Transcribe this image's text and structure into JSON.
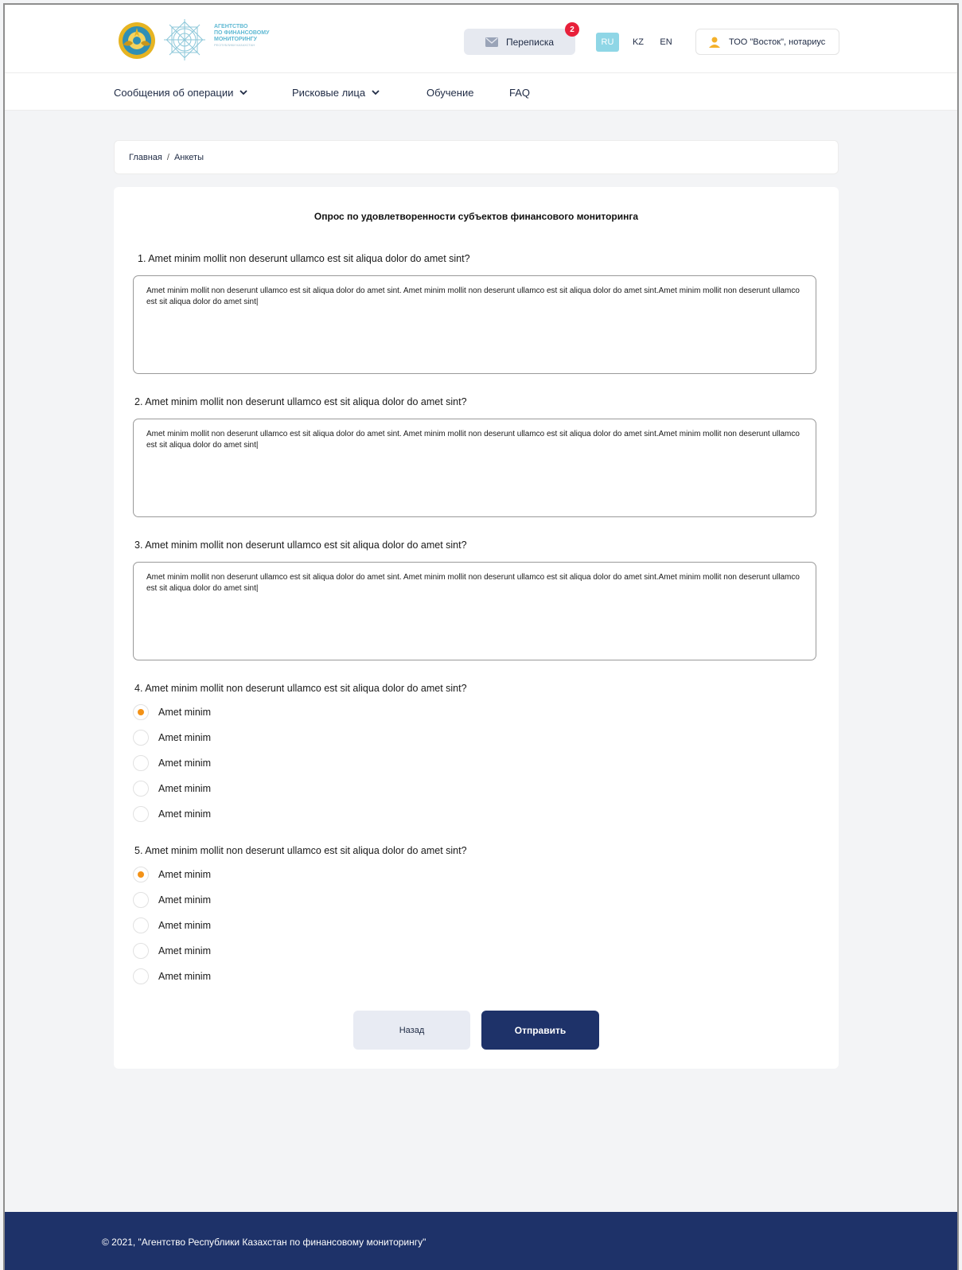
{
  "header": {
    "agency_name": [
      "Агентство",
      "по финансовому",
      "мониторингу"
    ],
    "agency_sub": "Республики Казахстан",
    "messages_label": "Переписка",
    "messages_badge": "2",
    "languages": [
      "RU",
      "KZ",
      "EN"
    ],
    "active_language": "RU",
    "user_label": "ТОО \"Восток\", нотариус"
  },
  "nav": {
    "items": [
      {
        "label": "Сообщения об операции",
        "dropdown": true
      },
      {
        "label": "Рисковые лица",
        "dropdown": true
      },
      {
        "label": "Обучение",
        "dropdown": false
      },
      {
        "label": "FAQ",
        "dropdown": false
      }
    ]
  },
  "breadcrumb": {
    "home": "Главная",
    "separator": "/",
    "current": "Анкеты"
  },
  "survey": {
    "title": "Опрос по удовлетворенности субъектов финансового мониторинга",
    "questions": [
      {
        "label": "1. Amet minim mollit non deserunt ullamco est sit aliqua dolor do amet sint?",
        "type": "text",
        "value": "Amet minim mollit non deserunt ullamco est sit aliqua dolor do amet sint. Amet minim mollit non deserunt ullamco est sit aliqua dolor do amet sint.Amet minim mollit non deserunt ullamco est sit aliqua dolor do amet sint|"
      },
      {
        "label": "2. Amet minim mollit non deserunt ullamco est sit aliqua dolor do amet sint?",
        "type": "text",
        "value": "Amet minim mollit non deserunt ullamco est sit aliqua dolor do amet sint. Amet minim mollit non deserunt ullamco est sit aliqua dolor do amet sint.Amet minim mollit non deserunt ullamco est sit aliqua dolor do amet sint|"
      },
      {
        "label": "3. Amet minim mollit non deserunt ullamco est sit aliqua dolor do amet sint?",
        "type": "text",
        "value": "Amet minim mollit non deserunt ullamco est sit aliqua dolor do amet sint. Amet minim mollit non deserunt ullamco est sit aliqua dolor do amet sint.Amet minim mollit non deserunt ullamco est sit aliqua dolor do amet sint|"
      },
      {
        "label": "4. Amet minim mollit non deserunt ullamco est sit aliqua dolor do amet sint?",
        "type": "radio",
        "options": [
          "Amet minim",
          "Amet minim",
          "Amet minim",
          "Amet minim",
          "Amet minim"
        ],
        "selected_index": 0
      },
      {
        "label": "5. Amet minim mollit non deserunt ullamco est sit aliqua dolor do amet sint?",
        "type": "radio",
        "options": [
          "Amet minim",
          "Amet minim",
          "Amet minim",
          "Amet minim",
          "Amet minim"
        ],
        "selected_index": 0
      }
    ],
    "back_label": "Назад",
    "submit_label": "Отправить"
  },
  "footer": {
    "copyright": "© 2021, \"Агентство Республики Казахстан по финансовому мониторингу\""
  },
  "colors": {
    "primary": "#1e3269",
    "accent": "#f39217",
    "badge": "#e8203a",
    "lang_active": "#8fd6e6"
  }
}
